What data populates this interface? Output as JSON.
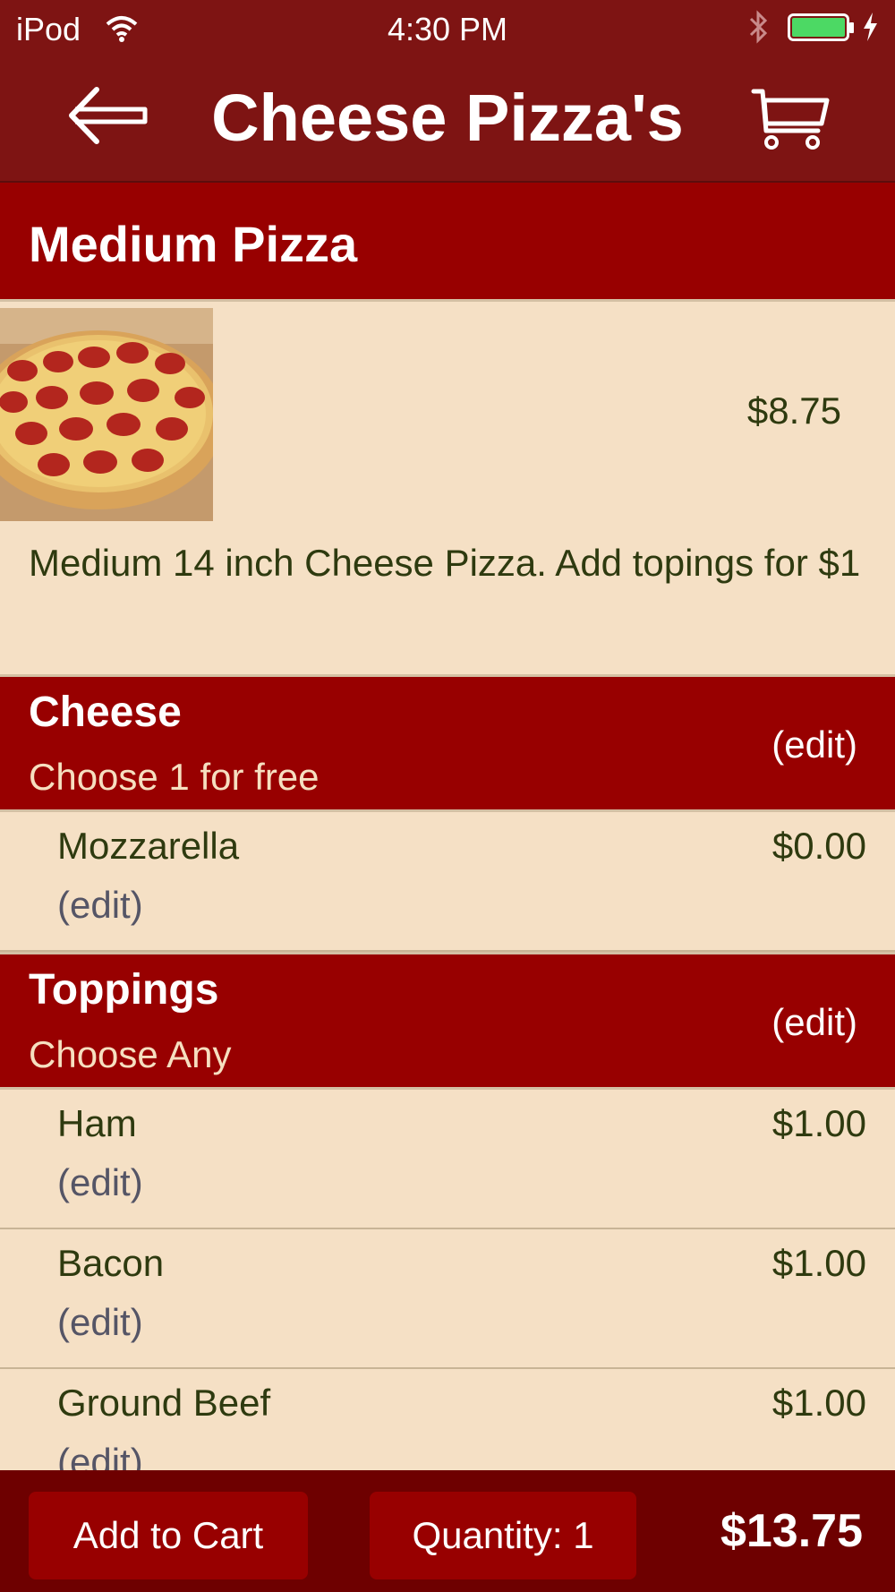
{
  "status_bar": {
    "carrier": "iPod",
    "time": "4:30 PM"
  },
  "nav": {
    "title": "Cheese Pizza's"
  },
  "product": {
    "name": "Medium Pizza",
    "price": "$8.75",
    "description": "Medium 14 inch Cheese Pizza. Add topings for $1"
  },
  "groups": [
    {
      "title": "Cheese",
      "subtitle": "Choose 1 for free",
      "edit_label": "(edit)",
      "options": [
        {
          "name": "Mozzarella",
          "price": "$0.00",
          "edit_label": "(edit)"
        }
      ]
    },
    {
      "title": "Toppings",
      "subtitle": "Choose Any",
      "edit_label": "(edit)",
      "options": [
        {
          "name": "Ham",
          "price": "$1.00",
          "edit_label": "(edit)"
        },
        {
          "name": "Bacon",
          "price": "$1.00",
          "edit_label": "(edit)"
        },
        {
          "name": "Ground Beef",
          "price": "$1.00",
          "edit_label": "(edit)"
        }
      ]
    }
  ],
  "bottom_bar": {
    "add_to_cart_label": "Add to Cart",
    "quantity_label": "Quantity: 1",
    "total": "$13.75"
  },
  "icons": {
    "back": "back-arrow-icon",
    "cart": "cart-icon",
    "wifi": "wifi-icon",
    "bluetooth": "bluetooth-icon",
    "battery": "battery-icon",
    "charging": "charging-bolt-icon"
  },
  "colors": {
    "nav_bar": "#7e1413",
    "section_header": "#980000",
    "background": "#f5e0c5",
    "bottom_bar": "#6e0000",
    "battery_fill": "#4cd964"
  }
}
